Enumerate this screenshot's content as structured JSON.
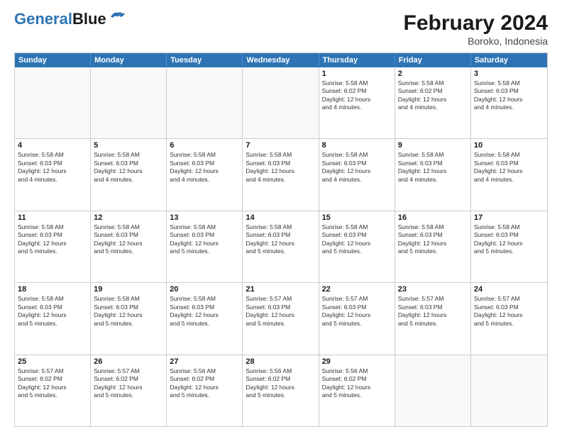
{
  "logo": {
    "part1": "General",
    "part2": "Blue"
  },
  "title": "February 2024",
  "location": "Boroko, Indonesia",
  "header_days": [
    "Sunday",
    "Monday",
    "Tuesday",
    "Wednesday",
    "Thursday",
    "Friday",
    "Saturday"
  ],
  "rows": [
    [
      {
        "day": "",
        "text": ""
      },
      {
        "day": "",
        "text": ""
      },
      {
        "day": "",
        "text": ""
      },
      {
        "day": "",
        "text": ""
      },
      {
        "day": "1",
        "text": "Sunrise: 5:58 AM\nSunset: 6:02 PM\nDaylight: 12 hours\nand 4 minutes."
      },
      {
        "day": "2",
        "text": "Sunrise: 5:58 AM\nSunset: 6:02 PM\nDaylight: 12 hours\nand 4 minutes."
      },
      {
        "day": "3",
        "text": "Sunrise: 5:58 AM\nSunset: 6:03 PM\nDaylight: 12 hours\nand 4 minutes."
      }
    ],
    [
      {
        "day": "4",
        "text": "Sunrise: 5:58 AM\nSunset: 6:03 PM\nDaylight: 12 hours\nand 4 minutes."
      },
      {
        "day": "5",
        "text": "Sunrise: 5:58 AM\nSunset: 6:03 PM\nDaylight: 12 hours\nand 4 minutes."
      },
      {
        "day": "6",
        "text": "Sunrise: 5:58 AM\nSunset: 6:03 PM\nDaylight: 12 hours\nand 4 minutes."
      },
      {
        "day": "7",
        "text": "Sunrise: 5:58 AM\nSunset: 6:03 PM\nDaylight: 12 hours\nand 4 minutes."
      },
      {
        "day": "8",
        "text": "Sunrise: 5:58 AM\nSunset: 6:03 PM\nDaylight: 12 hours\nand 4 minutes."
      },
      {
        "day": "9",
        "text": "Sunrise: 5:58 AM\nSunset: 6:03 PM\nDaylight: 12 hours\nand 4 minutes."
      },
      {
        "day": "10",
        "text": "Sunrise: 5:58 AM\nSunset: 6:03 PM\nDaylight: 12 hours\nand 4 minutes."
      }
    ],
    [
      {
        "day": "11",
        "text": "Sunrise: 5:58 AM\nSunset: 6:03 PM\nDaylight: 12 hours\nand 5 minutes."
      },
      {
        "day": "12",
        "text": "Sunrise: 5:58 AM\nSunset: 6:03 PM\nDaylight: 12 hours\nand 5 minutes."
      },
      {
        "day": "13",
        "text": "Sunrise: 5:58 AM\nSunset: 6:03 PM\nDaylight: 12 hours\nand 5 minutes."
      },
      {
        "day": "14",
        "text": "Sunrise: 5:58 AM\nSunset: 6:03 PM\nDaylight: 12 hours\nand 5 minutes."
      },
      {
        "day": "15",
        "text": "Sunrise: 5:58 AM\nSunset: 6:03 PM\nDaylight: 12 hours\nand 5 minutes."
      },
      {
        "day": "16",
        "text": "Sunrise: 5:58 AM\nSunset: 6:03 PM\nDaylight: 12 hours\nand 5 minutes."
      },
      {
        "day": "17",
        "text": "Sunrise: 5:58 AM\nSunset: 6:03 PM\nDaylight: 12 hours\nand 5 minutes."
      }
    ],
    [
      {
        "day": "18",
        "text": "Sunrise: 5:58 AM\nSunset: 6:03 PM\nDaylight: 12 hours\nand 5 minutes."
      },
      {
        "day": "19",
        "text": "Sunrise: 5:58 AM\nSunset: 6:03 PM\nDaylight: 12 hours\nand 5 minutes."
      },
      {
        "day": "20",
        "text": "Sunrise: 5:58 AM\nSunset: 6:03 PM\nDaylight: 12 hours\nand 5 minutes."
      },
      {
        "day": "21",
        "text": "Sunrise: 5:57 AM\nSunset: 6:03 PM\nDaylight: 12 hours\nand 5 minutes."
      },
      {
        "day": "22",
        "text": "Sunrise: 5:57 AM\nSunset: 6:03 PM\nDaylight: 12 hours\nand 5 minutes."
      },
      {
        "day": "23",
        "text": "Sunrise: 5:57 AM\nSunset: 6:03 PM\nDaylight: 12 hours\nand 5 minutes."
      },
      {
        "day": "24",
        "text": "Sunrise: 5:57 AM\nSunset: 6:03 PM\nDaylight: 12 hours\nand 5 minutes."
      }
    ],
    [
      {
        "day": "25",
        "text": "Sunrise: 5:57 AM\nSunset: 6:02 PM\nDaylight: 12 hours\nand 5 minutes."
      },
      {
        "day": "26",
        "text": "Sunrise: 5:57 AM\nSunset: 6:02 PM\nDaylight: 12 hours\nand 5 minutes."
      },
      {
        "day": "27",
        "text": "Sunrise: 5:56 AM\nSunset: 6:02 PM\nDaylight: 12 hours\nand 5 minutes."
      },
      {
        "day": "28",
        "text": "Sunrise: 5:56 AM\nSunset: 6:02 PM\nDaylight: 12 hours\nand 5 minutes."
      },
      {
        "day": "29",
        "text": "Sunrise: 5:56 AM\nSunset: 6:02 PM\nDaylight: 12 hours\nand 5 minutes."
      },
      {
        "day": "",
        "text": ""
      },
      {
        "day": "",
        "text": ""
      }
    ]
  ]
}
